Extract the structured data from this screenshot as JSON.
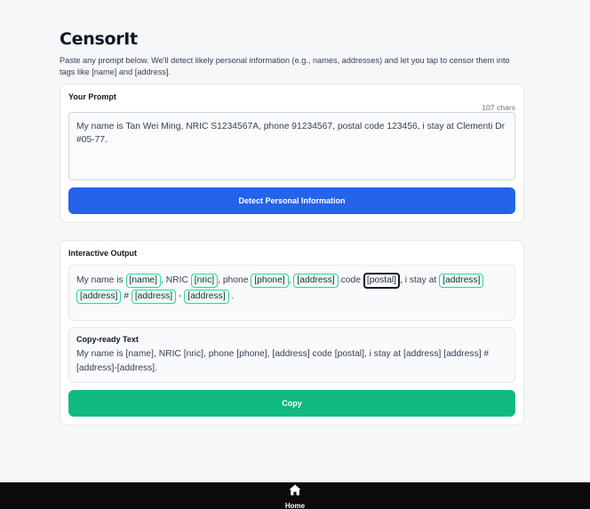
{
  "app": {
    "title": "CensorIt",
    "description": "Paste any prompt below. We'll detect likely personal information (e.g., names, addresses) and let you tap to censor them into tags like [name] and [address]."
  },
  "prompt_card": {
    "title": "Your Prompt",
    "char_count": "107 chars",
    "value": "My name is Tan Wei Ming, NRIC S1234567A, phone 91234567, postal code 123456, i stay at  Clementi Dr #05-77.",
    "detect_button": "Detect Personal Information"
  },
  "output_card": {
    "title": "Interactive Output",
    "segments": [
      {
        "text": "My name is ",
        "tag": false
      },
      {
        "text": "[name]",
        "tag": true,
        "active": false
      },
      {
        "text": ", NRIC ",
        "tag": false
      },
      {
        "text": "[nric]",
        "tag": true,
        "active": false
      },
      {
        "text": ", phone ",
        "tag": false
      },
      {
        "text": "[phone]",
        "tag": true,
        "active": false
      },
      {
        "text": ", ",
        "tag": false
      },
      {
        "text": "[address]",
        "tag": true,
        "active": false
      },
      {
        "text": " code ",
        "tag": false
      },
      {
        "text": "[postal]",
        "tag": true,
        "active": true
      },
      {
        "text": ", i stay at  ",
        "tag": false
      },
      {
        "text": "[address]",
        "tag": true,
        "active": false
      },
      {
        "text": " ",
        "tag": false
      },
      {
        "text": "[address]",
        "tag": true,
        "active": false
      },
      {
        "text": " # ",
        "tag": false
      },
      {
        "text": "[address]",
        "tag": true,
        "active": false
      },
      {
        "text": " - ",
        "tag": false
      },
      {
        "text": "[address]",
        "tag": true,
        "active": false
      },
      {
        "text": " .",
        "tag": false
      }
    ],
    "copy_title": "Copy-ready Text",
    "copy_text": "My name is [name], NRIC [nric], phone [phone], [address] code [postal], i stay at  [address] [address] #[address]-[address].",
    "copy_button": "Copy"
  },
  "nav": {
    "home_label": "Home",
    "home_icon": "home-icon"
  },
  "colors": {
    "primary": "#2563eb",
    "success": "#10b981",
    "tag_border": "#34d399",
    "nav_bg": "#0b0b0b"
  }
}
